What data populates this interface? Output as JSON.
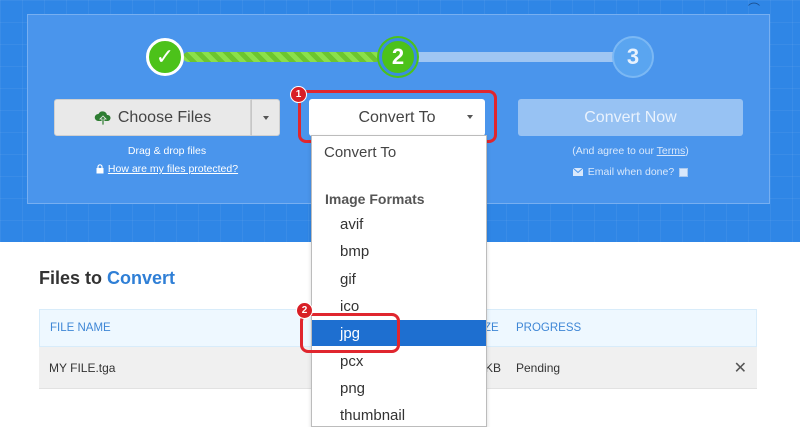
{
  "steps": {
    "step1": "✓",
    "step2": "2",
    "step3": "3"
  },
  "upload": {
    "choose_label": "Choose Files",
    "drag_drop": "Drag & drop files",
    "protected_link": "How are my files protected?"
  },
  "convert_to": {
    "label": "Convert To"
  },
  "convert_now": {
    "label": "Convert Now",
    "agree_prefix": "(And agree to our ",
    "terms": "Terms",
    "agree_suffix": ")",
    "email_label": "Email when done?"
  },
  "badges": {
    "one": "1",
    "two": "2"
  },
  "files": {
    "title_plain": "Files to ",
    "title_accent": "Convert",
    "columns": [
      "FILE NAME",
      "ZE",
      "PROGRESS"
    ],
    "rows": [
      {
        "name": "MY FILE.tga",
        "size": "KB",
        "status": "Pending"
      }
    ]
  },
  "dropdown": {
    "first": "Convert To",
    "group": "Image Formats",
    "options": [
      "avif",
      "bmp",
      "gif",
      "ico",
      "jpg",
      "pcx",
      "png",
      "thumbnail"
    ],
    "selected": "jpg"
  },
  "colors": {
    "brand_blue": "#2f86e6",
    "accent_green": "#4cc21a",
    "highlight_red": "#e0262e",
    "selected_blue": "#1e6fd0"
  }
}
